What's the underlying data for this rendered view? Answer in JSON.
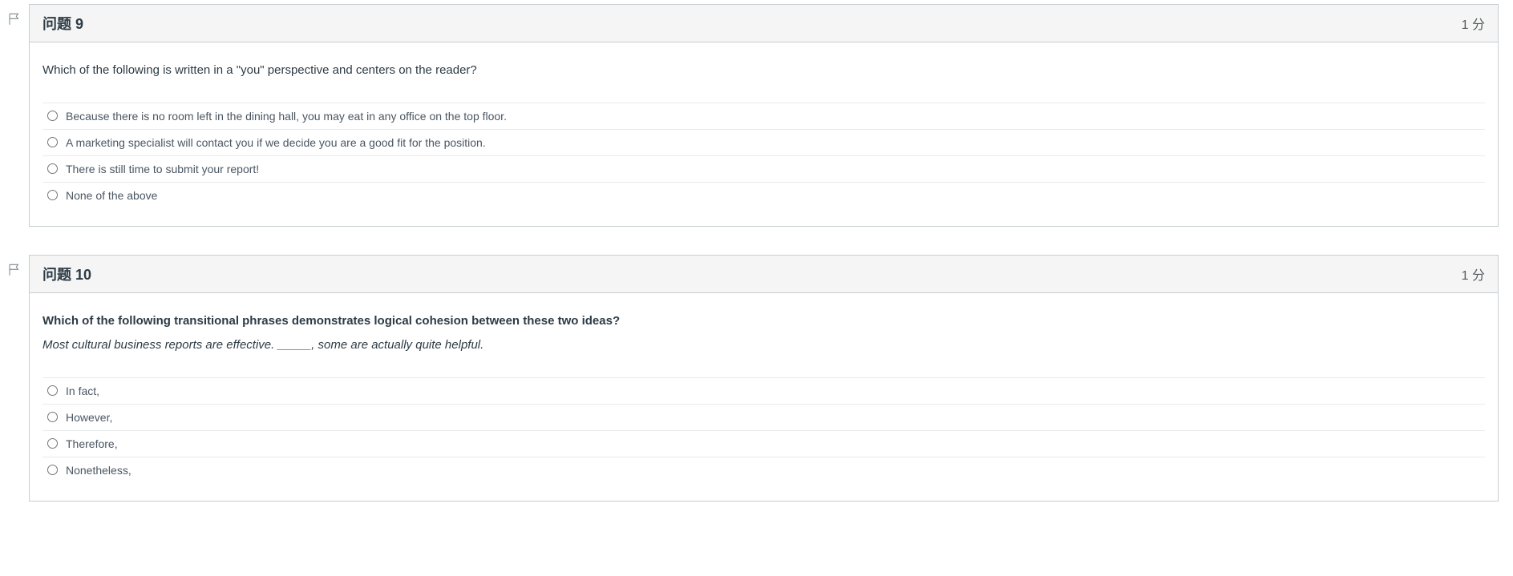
{
  "questions": [
    {
      "id": "q9",
      "title": "问题 9",
      "points": "1 分",
      "prompt": "Which of the following is written in a \"you\" perspective and centers on the reader?",
      "subtext": "",
      "prompt_bold": false,
      "answers": [
        "Because there is no room left in the dining hall, you may eat in any office on the top floor.",
        "A marketing specialist will contact you if we decide you are a good fit for the position.",
        "There is still time to submit your report!",
        "None of the above"
      ]
    },
    {
      "id": "q10",
      "title": "问题 10",
      "points": "1 分",
      "prompt": "Which of the following transitional phrases demonstrates logical cohesion between these two ideas?",
      "subtext": "Most cultural business reports are effective. _____, some are actually quite helpful.",
      "prompt_bold": true,
      "answers": [
        "In fact,",
        "However,",
        "Therefore,",
        "Nonetheless,"
      ]
    }
  ]
}
